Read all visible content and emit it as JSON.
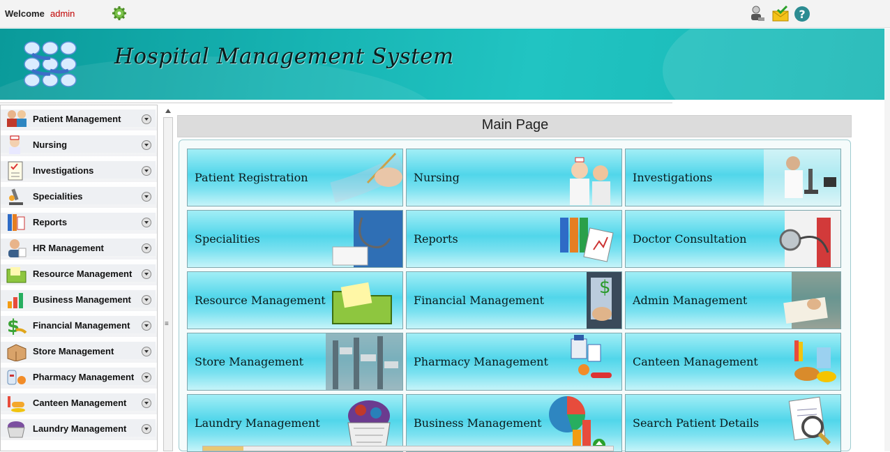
{
  "topbar": {
    "welcome_label": "Welcome",
    "username": "admin",
    "icons": [
      "settings-gear-icon",
      "user-switch-icon",
      "mail-icon",
      "help-icon"
    ]
  },
  "banner": {
    "title": "Hospital Management System"
  },
  "sidebar": {
    "items": [
      {
        "label": "Patient Management",
        "icon": "patients-icon"
      },
      {
        "label": "Nursing",
        "icon": "nurse-icon"
      },
      {
        "label": "Investigations",
        "icon": "checklist-icon"
      },
      {
        "label": "Specialities",
        "icon": "microscope-icon"
      },
      {
        "label": "Reports",
        "icon": "binders-icon"
      },
      {
        "label": "HR Management",
        "icon": "person-icon"
      },
      {
        "label": "Resource Management",
        "icon": "folder-icon"
      },
      {
        "label": "Business Management",
        "icon": "chart-icon"
      },
      {
        "label": "Financial Management",
        "icon": "money-icon"
      },
      {
        "label": "Store Management",
        "icon": "box-icon"
      },
      {
        "label": "Pharmacy Management",
        "icon": "pills-icon"
      },
      {
        "label": "Canteen Management",
        "icon": "food-icon"
      },
      {
        "label": "Laundry Management",
        "icon": "laundry-icon"
      }
    ]
  },
  "main": {
    "title": "Main Page",
    "tiles": [
      {
        "label": "Patient Registration",
        "icon": "pen-writing-icon"
      },
      {
        "label": "Nursing",
        "icon": "nurses-icon"
      },
      {
        "label": "Investigations",
        "icon": "lab-microscope-icon"
      },
      {
        "label": "Specialities",
        "icon": "stethoscope-doctor-icon"
      },
      {
        "label": "Reports",
        "icon": "report-binders-icon"
      },
      {
        "label": "Doctor Consultation",
        "icon": "stethoscope-icon"
      },
      {
        "label": "Resource Management",
        "icon": "green-folder-icon"
      },
      {
        "label": "Financial Management",
        "icon": "calculator-icon"
      },
      {
        "label": "Admin Management",
        "icon": "desk-papers-icon"
      },
      {
        "label": "Store Management",
        "icon": "warehouse-shelves-icon"
      },
      {
        "label": "Pharmacy Management",
        "icon": "medicine-bottles-icon"
      },
      {
        "label": "Canteen Management",
        "icon": "fast-food-icon"
      },
      {
        "label": "Laundry Management",
        "icon": "laundry-basket-icon"
      },
      {
        "label": "Business Management",
        "icon": "pie-chart-icon"
      },
      {
        "label": "Search Patient Details",
        "icon": "magnifier-document-icon"
      }
    ]
  },
  "colors": {
    "banner": "#17b4b3",
    "tile_light": "#a2eef6",
    "tile_mid": "#51d6ea",
    "username": "#c00000"
  }
}
